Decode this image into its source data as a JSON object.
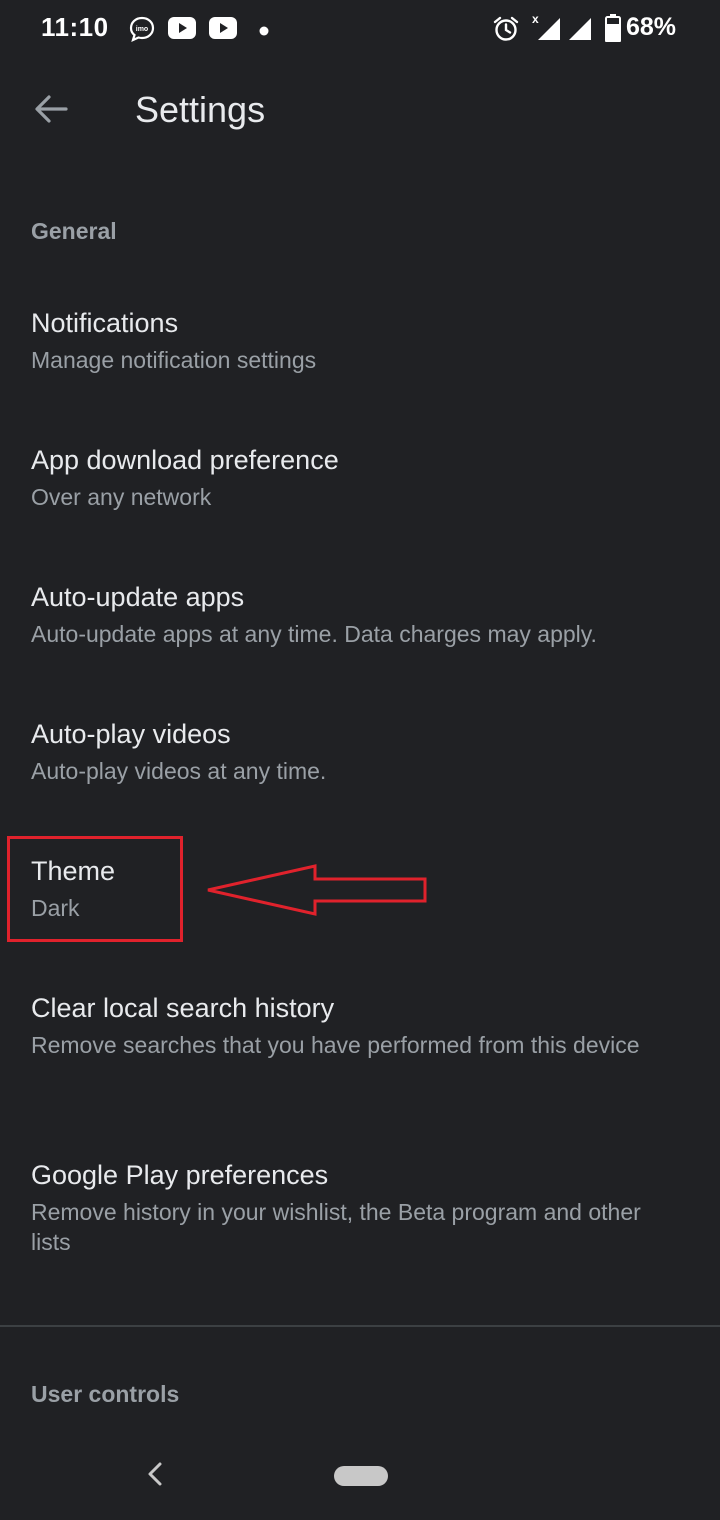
{
  "status_bar": {
    "time": "11:10",
    "battery": "68%",
    "icons": [
      "imo-icon",
      "youtube-icon",
      "youtube-icon",
      "dot-icon",
      "alarm-icon",
      "signal-icon",
      "signal-icon",
      "battery-icon"
    ]
  },
  "app_bar": {
    "title": "Settings",
    "back_icon": "arrow-back-icon"
  },
  "sections": {
    "general": "General",
    "user_controls": "User controls"
  },
  "items": [
    {
      "title": "Notifications",
      "subtitle": "Manage notification settings"
    },
    {
      "title": "App download preference",
      "subtitle": "Over any network"
    },
    {
      "title": "Auto-update apps",
      "subtitle": "Auto-update apps at any time. Data charges may apply."
    },
    {
      "title": "Auto-play videos",
      "subtitle": "Auto-play videos at any time."
    },
    {
      "title": "Theme",
      "subtitle": "Dark"
    },
    {
      "title": "Clear local search history",
      "subtitle": "Remove searches that you have performed from this device"
    },
    {
      "title": "Google Play preferences",
      "subtitle": "Remove history in your wishlist, the Beta program and other lists"
    }
  ],
  "colors": {
    "background": "#202124",
    "text_primary": "#e8eaed",
    "text_secondary": "#9aa0a6",
    "annotation": "#e0222c"
  }
}
